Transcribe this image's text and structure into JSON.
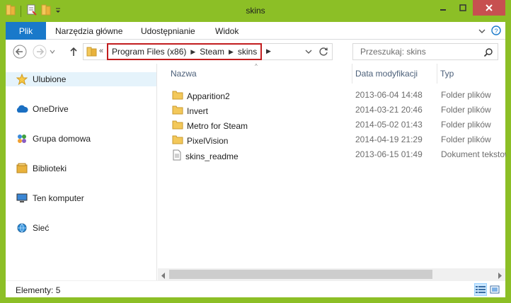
{
  "window": {
    "title": "skins"
  },
  "ribbon": {
    "file_label": "Plik",
    "tabs": [
      "Narzędzia główne",
      "Udostępnianie",
      "Widok"
    ]
  },
  "address": {
    "overflow": "«",
    "crumbs": [
      "Program Files (x86)",
      "Steam",
      "skins"
    ]
  },
  "search": {
    "placeholder": "Przeszukaj: skins"
  },
  "nav": {
    "items": [
      {
        "label": "Ulubione",
        "icon": "star-icon"
      },
      {
        "label": "OneDrive",
        "icon": "cloud-icon"
      },
      {
        "label": "Grupa domowa",
        "icon": "homegroup-icon"
      },
      {
        "label": "Biblioteki",
        "icon": "library-icon"
      },
      {
        "label": "Ten komputer",
        "icon": "computer-icon"
      },
      {
        "label": "Sieć",
        "icon": "network-icon"
      }
    ]
  },
  "columns": {
    "name": "Nazwa",
    "date": "Data modyfikacji",
    "type": "Typ"
  },
  "files": [
    {
      "name": "Apparition2",
      "date": "2013-06-04 14:48",
      "type": "Folder plików",
      "icon": "folder-icon"
    },
    {
      "name": "Invert",
      "date": "2014-03-21 20:46",
      "type": "Folder plików",
      "icon": "folder-icon"
    },
    {
      "name": "Metro for Steam",
      "date": "2014-05-02 01:43",
      "type": "Folder plików",
      "icon": "folder-icon"
    },
    {
      "name": "PixelVision",
      "date": "2014-04-19 21:29",
      "type": "Folder plików",
      "icon": "folder-icon"
    },
    {
      "name": "skins_readme",
      "date": "2013-06-15 01:49",
      "type": "Dokument tekstowy",
      "icon": "text-file-icon"
    }
  ],
  "status": {
    "items_count": "Elementy: 5"
  },
  "colors": {
    "frame": "#8cbf26",
    "file_tab": "#1979ca",
    "close_button": "#c75050",
    "highlight_border": "#c21d1f",
    "selected_nav": "#e5f3fb"
  }
}
